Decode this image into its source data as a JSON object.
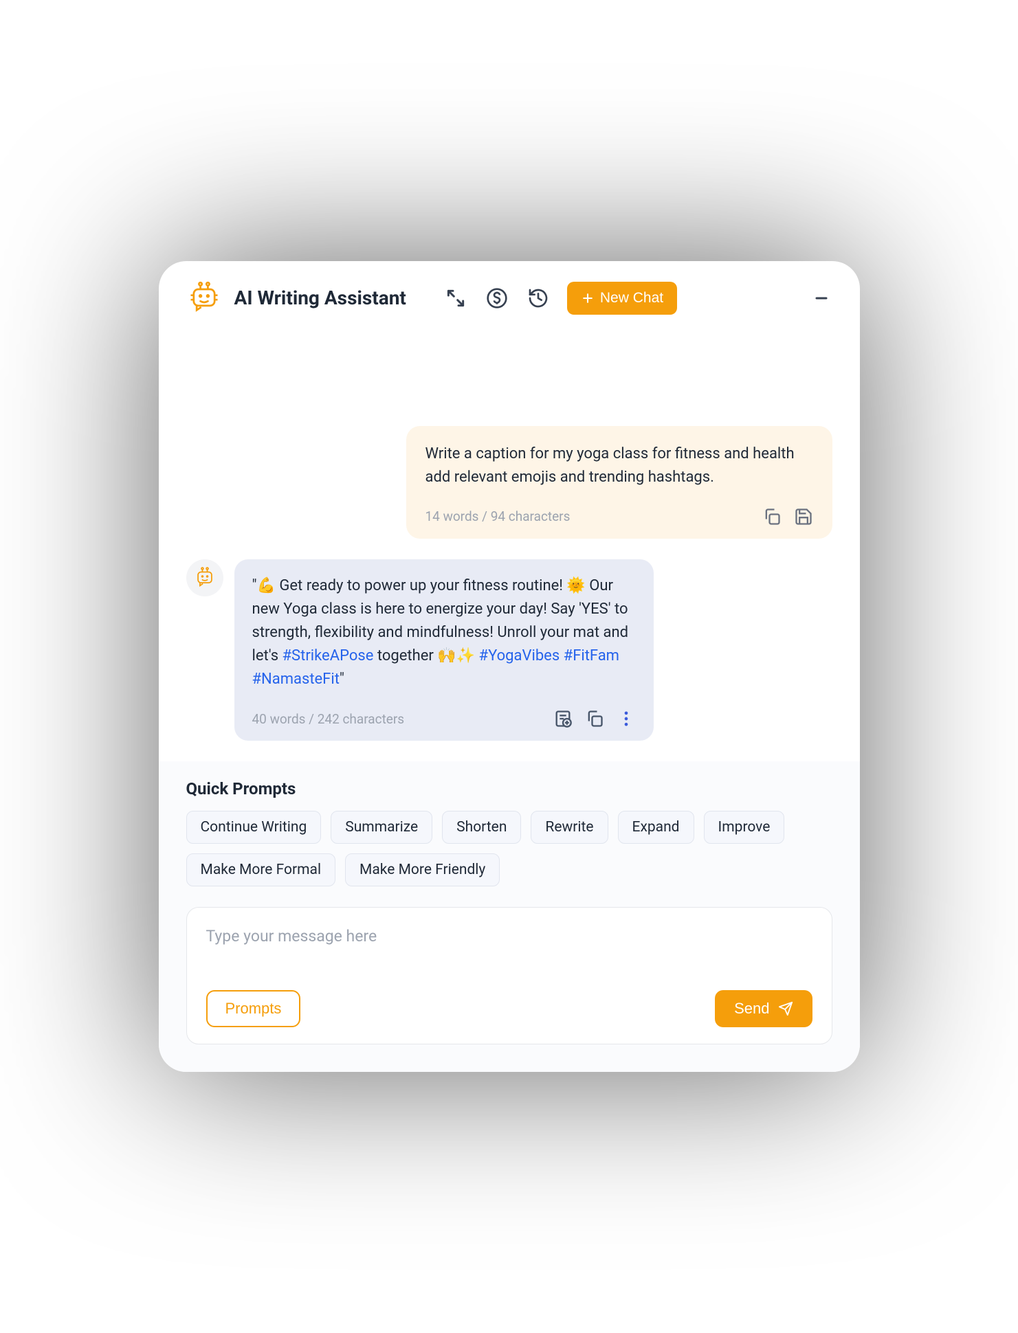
{
  "header": {
    "title": "AI Writing Assistant",
    "new_chat_label": "New Chat"
  },
  "user_message": {
    "line1": "Write a caption for my yoga class for fitness and health",
    "line2": "add relevant emojis and trending hashtags.",
    "stats": "14 words / 94 characters"
  },
  "ai_message": {
    "pre1": "\"💪 Get ready to power up your fitness routine! 🌞 Our new Yoga class is here to energize your day! Say 'YES' to strength, flexibility and mindfulness!  Unroll your mat and let's ",
    "tag1": "#StrikeAPose",
    "mid1": " together 🙌✨ ",
    "tag2": "#YogaVibes",
    "sp1": " ",
    "tag3": "#FitFam",
    "sp2": " ",
    "tag4": "#NamasteFit",
    "post1": "\"",
    "stats": "40 words / 242 characters"
  },
  "quick": {
    "title": "Quick Prompts",
    "items": [
      "Continue Writing",
      "Summarize",
      "Shorten",
      "Rewrite",
      "Expand",
      "Improve",
      "Make More Formal",
      "Make More Friendly"
    ]
  },
  "input": {
    "placeholder": "Type your message here",
    "prompts_label": "Prompts",
    "send_label": "Send"
  }
}
